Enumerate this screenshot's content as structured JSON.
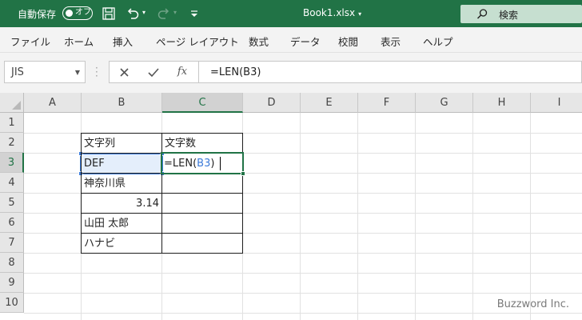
{
  "titlebar": {
    "autosave_label": "自動保存",
    "toggle_label": "オフ",
    "doc_title": "Book1.xlsx",
    "search_placeholder": "検索"
  },
  "ribbon_tabs": [
    "ファイル",
    "ホーム",
    "挿入",
    "ページ レイアウト",
    "数式",
    "データ",
    "校閲",
    "表示",
    "ヘルプ"
  ],
  "formula_bar": {
    "name_box": "JIS",
    "formula": "=LEN(B3)",
    "fx_label": "fx"
  },
  "sheet": {
    "columns": [
      "A",
      "B",
      "C",
      "D",
      "E",
      "F",
      "G",
      "H",
      "I"
    ],
    "rows": [
      "1",
      "2",
      "3",
      "4",
      "5",
      "6",
      "7",
      "8",
      "9",
      "10"
    ],
    "selected_column": "C",
    "selected_row": "3",
    "cells": {
      "B2": "文字列",
      "C2": "文字数",
      "B3": "DEF",
      "C3_prefix": "=LEN(",
      "C3_ref": "B3",
      "C3_suffix": ")",
      "B4": "神奈川県",
      "B5": "3.14",
      "B6": "山田 太郎",
      "B7": "ハナビ"
    },
    "ref_color": "#3c7bd9",
    "accent_color": "#217346"
  },
  "watermark": "Buzzword Inc."
}
